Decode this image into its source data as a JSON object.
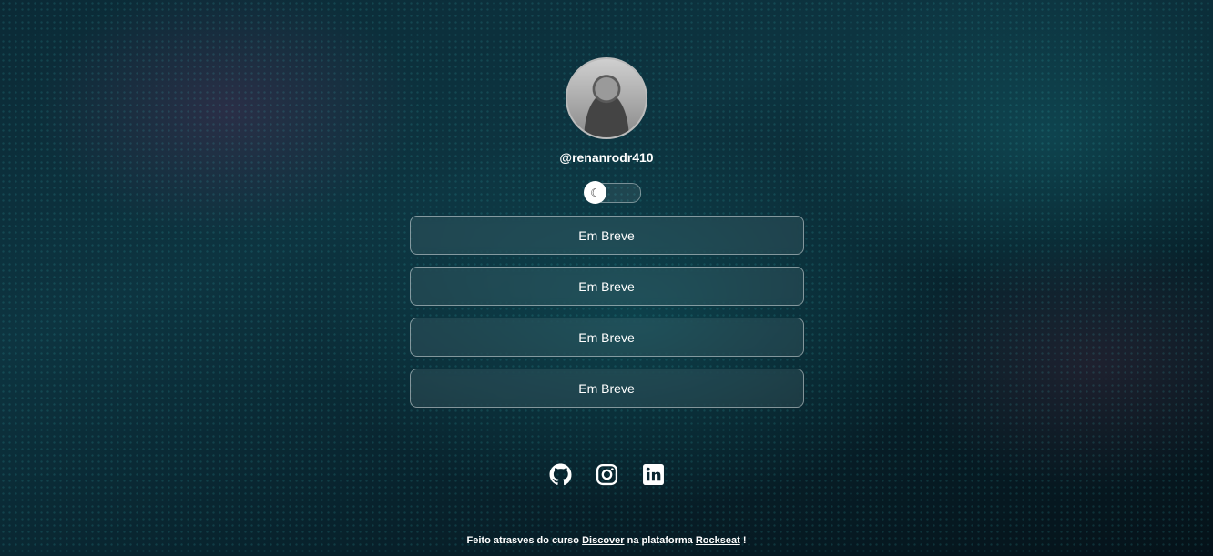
{
  "profile": {
    "handle": "@renanrodr410"
  },
  "theme_toggle": {
    "icon": "moon-icon"
  },
  "links": [
    {
      "label": "Em Breve"
    },
    {
      "label": "Em Breve"
    },
    {
      "label": "Em Breve"
    },
    {
      "label": "Em Breve"
    }
  ],
  "social": [
    "github-icon",
    "instagram-icon",
    "linkedin-icon"
  ],
  "footer": {
    "prefix": "Feito atrasves do curso",
    "course": "Discover",
    "middle": "na plataforma",
    "platform": "Rockseat",
    "suffix": "!"
  }
}
